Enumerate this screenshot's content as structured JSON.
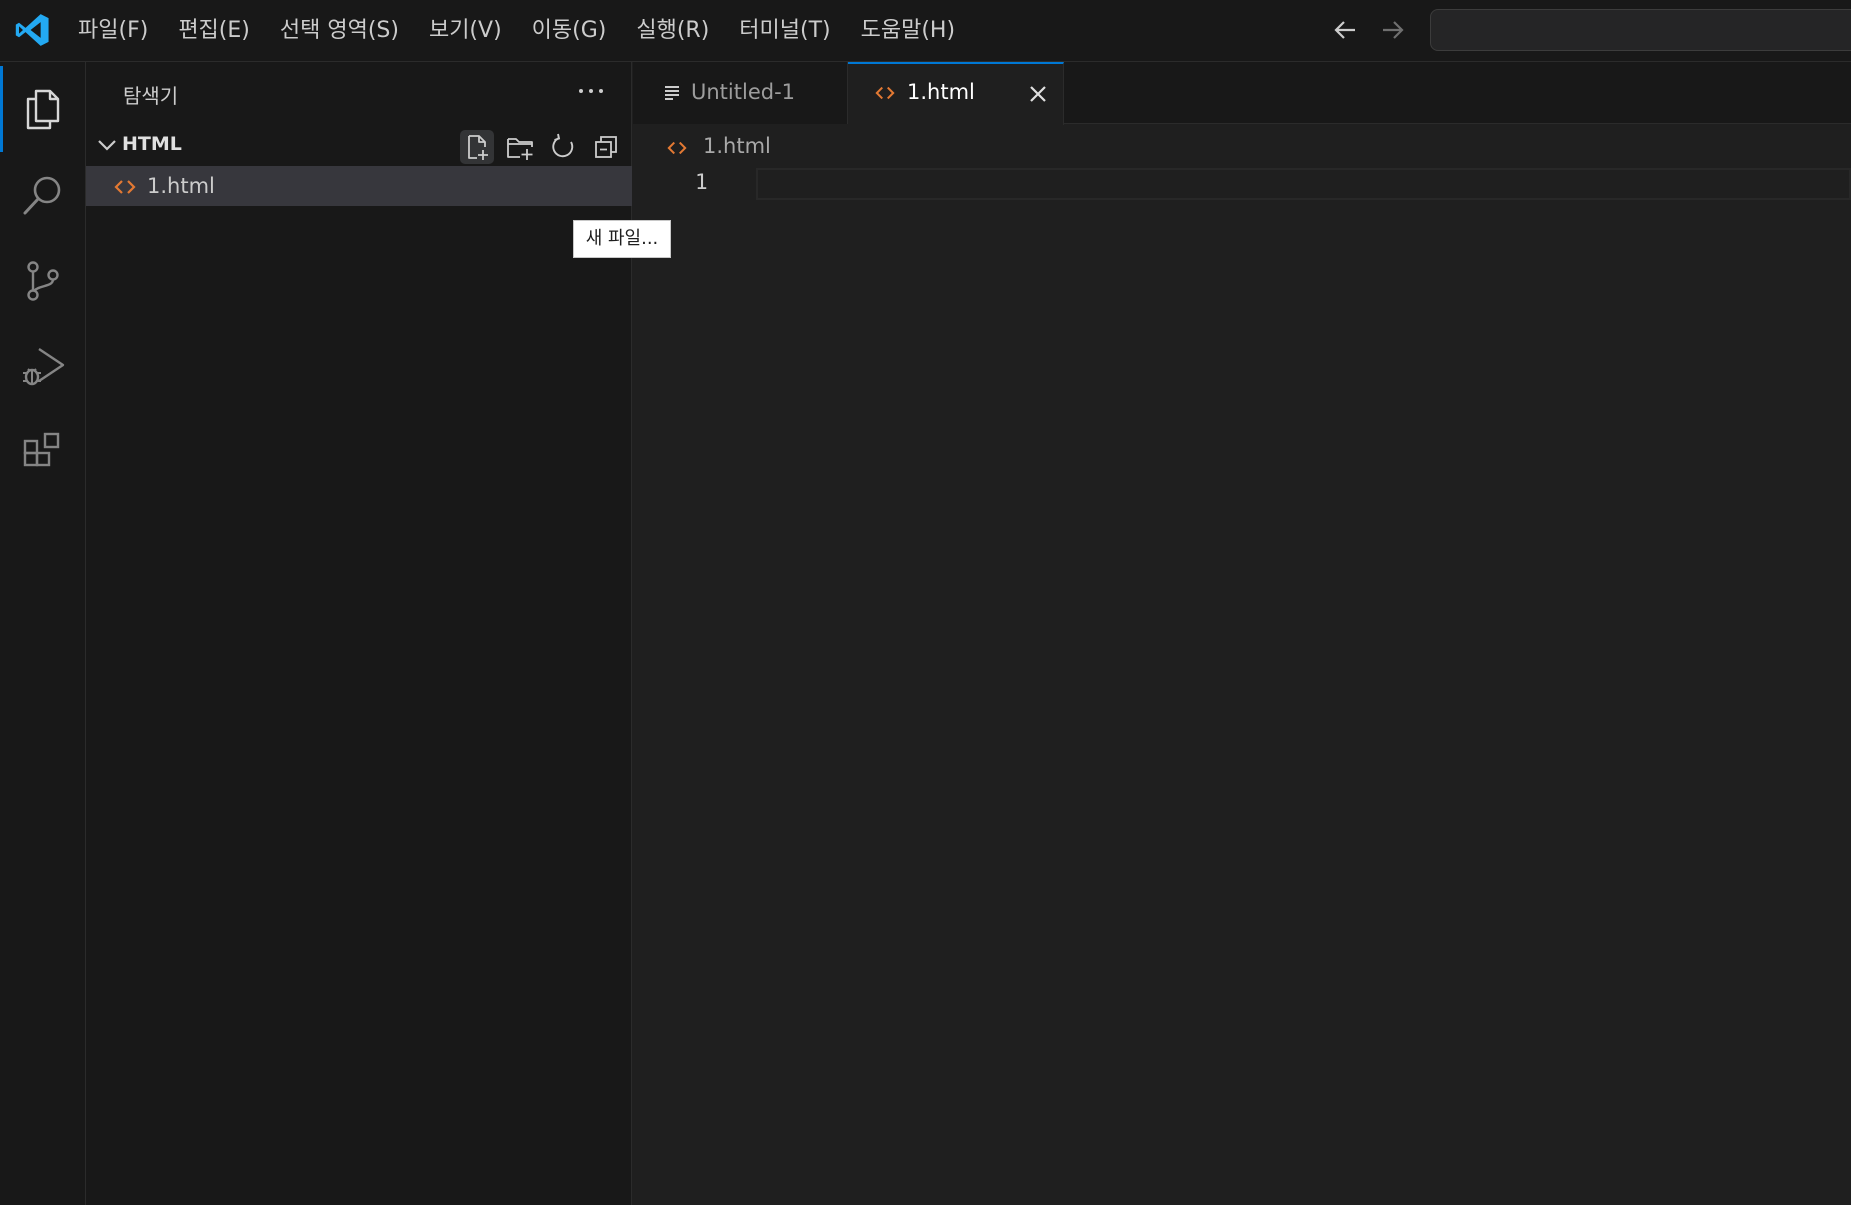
{
  "menu": [
    "파일(F)",
    "편집(E)",
    "선택 영역(S)",
    "보기(V)",
    "이동(G)",
    "실행(R)",
    "터미널(T)",
    "도움말(H)"
  ],
  "sidebar": {
    "title": "탐색기",
    "folder_name": "HTML",
    "file_label": "1.html",
    "tooltip": "새 파일..."
  },
  "tabs": [
    {
      "label": "Untitled-1",
      "icon": "lines-icon"
    },
    {
      "label": "1.html",
      "icon": "html-code-icon",
      "active": true
    }
  ],
  "breadcrumb": {
    "file": "1.html"
  },
  "editor": {
    "line_numbers": [
      "1"
    ]
  },
  "colors": {
    "accent": "#0078d4",
    "html_icon": "#e37933",
    "logo": "#23a9f2"
  }
}
